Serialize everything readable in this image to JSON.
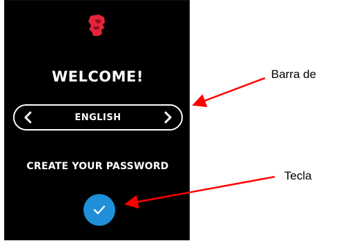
{
  "device": {
    "logo_icon": "kingston-head-logo-icon",
    "brand_color": "#e5243b",
    "welcome_title": "WELCOME!",
    "language_selector": {
      "selected": "ENGLISH",
      "prev_icon": "chevron-left-icon",
      "next_icon": "chevron-right-icon"
    },
    "create_password_label": "CREATE YOUR PASSWORD",
    "confirm_button": {
      "icon": "checkmark-icon",
      "color": "#1e8fd8"
    }
  },
  "annotations": {
    "language_bar_label": "Barra de",
    "key_label": "Tecla",
    "arrow_color": "#ff0000"
  }
}
